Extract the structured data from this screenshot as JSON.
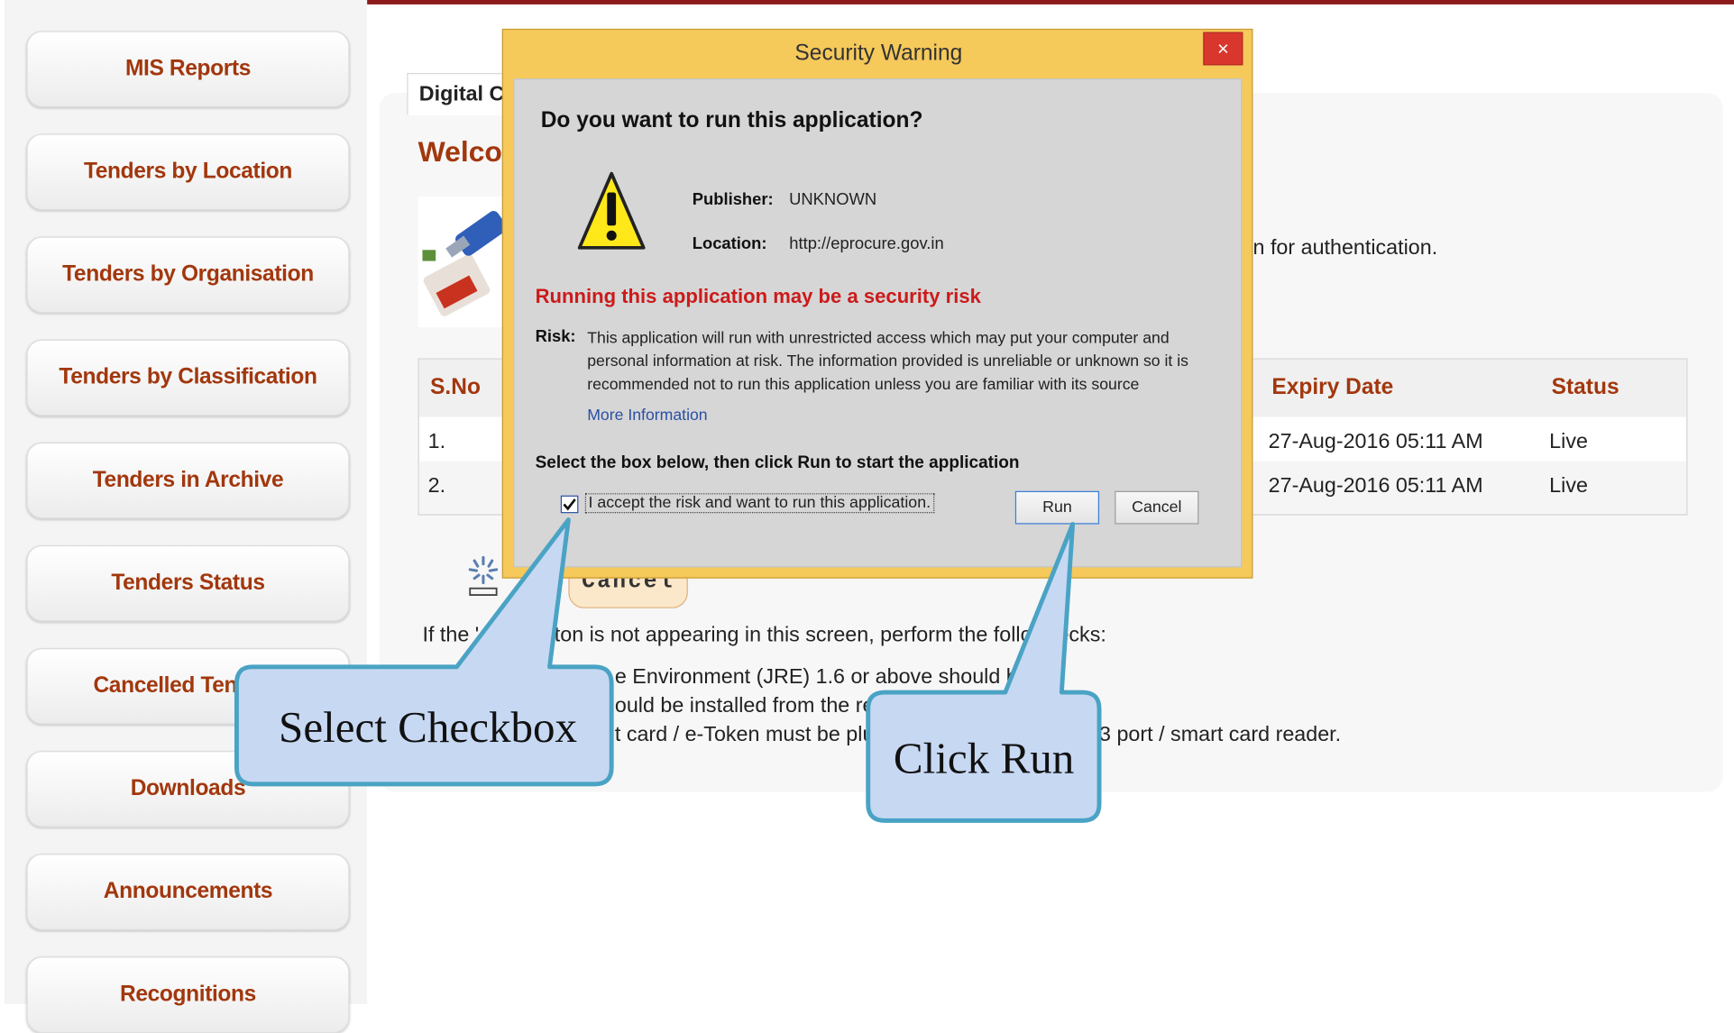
{
  "sidebar": {
    "items": [
      "MIS Reports",
      "Tenders by Location",
      "Tenders by Organisation",
      "Tenders by Classification",
      "Tenders in Archive",
      "Tenders Status",
      "Cancelled Tenders",
      "Downloads",
      "Announcements",
      "Recognitions"
    ]
  },
  "page": {
    "tab_label": "Digital C",
    "welcome": "Welcor",
    "auth_text": "n for authentication.",
    "table": {
      "headers": {
        "sno": "S.No",
        "expiry": "Expiry Date",
        "status": "Status"
      },
      "rows": [
        {
          "sno": "1.",
          "expiry": "27-Aug-2016 05:11 AM",
          "status": "Live"
        },
        {
          "sno": "2.",
          "expiry": "27-Aug-2016 05:11 AM",
          "status": "Live"
        }
      ]
    },
    "cancel_label": "Cancel",
    "instructions": {
      "intro_left": "If the '",
      "intro_mid": "tton is not appearing in this screen, perform the followi",
      "intro_right": "ecks:",
      "item1": "e Environment (JRE) 1.6 or above should be ins",
      "item2": "ould be installed from the reso",
      "item3_left": "t card / e-Token must be plug",
      "item3_right": "3 port / smart card reader."
    }
  },
  "dialog": {
    "title": "Security Warning",
    "close_glyph": "×",
    "question": "Do you want to run this application?",
    "publisher_label": "Publisher:",
    "publisher_value": "UNKNOWN",
    "location_label": "Location:",
    "location_value": "http://eprocure.gov.in",
    "risk_heading": "Running this application may be a security risk",
    "risk_label": "Risk:",
    "risk_text": "This application will run with unrestricted access which may put your computer and personal information at risk. The information provided is unreliable or unknown so it is recommended not to run this application unless you are familiar with its source",
    "more_info": "More Information",
    "select_text": "Select the box below, then click Run to start the application",
    "accept_text": "I accept the risk and want to run this application.",
    "accept_checked": true,
    "run_label": "Run",
    "cancel_label": "Cancel"
  },
  "callouts": {
    "select_checkbox": "Select Checkbox",
    "click_run": "Click Run",
    "fill_color": "#c7d8f3",
    "border_color": "#4aa3c4"
  },
  "colors": {
    "accent": "#a2370d",
    "dialog_frame": "#f5c95a",
    "risk_red": "#cc1a1a"
  }
}
